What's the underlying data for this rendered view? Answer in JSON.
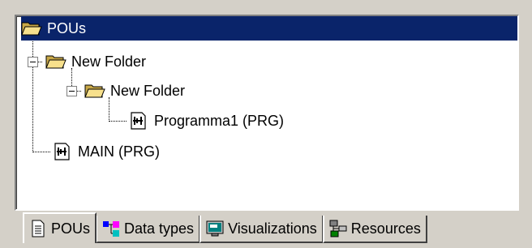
{
  "tree": {
    "root": {
      "label": "POUs",
      "icon": "folder-open-icon",
      "selected": true
    },
    "items": [
      {
        "label": "New Folder",
        "icon": "folder-open-icon",
        "expander": "minus"
      },
      {
        "label": "New Folder",
        "icon": "folder-open-icon",
        "expander": "minus"
      },
      {
        "label": "Programma1 (PRG)",
        "icon": "program-pou-icon"
      },
      {
        "label": "MAIN (PRG)",
        "icon": "program-pou-icon"
      }
    ]
  },
  "tabs": [
    {
      "label": "POUs",
      "icon": "document-icon",
      "active": true
    },
    {
      "label": "Data types",
      "icon": "data-types-icon",
      "active": false
    },
    {
      "label": "Visualizations",
      "icon": "visualization-icon",
      "active": false
    },
    {
      "label": "Resources",
      "icon": "resources-icon",
      "active": false
    }
  ],
  "colors": {
    "selection": "#0a246a",
    "folder": "#f7e08c",
    "chrome": "#d4d0c8"
  }
}
